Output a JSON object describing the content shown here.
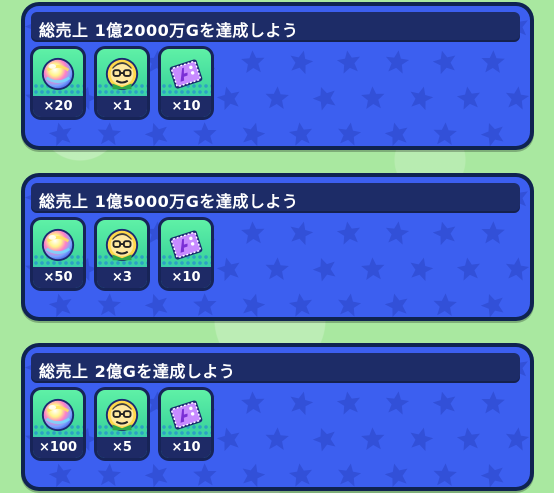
{
  "missions": [
    {
      "title": "総売上 1億2000万Gを達成しよう",
      "rewards": [
        {
          "icon": "rainbow-orb-icon",
          "count": "×20"
        },
        {
          "icon": "character-face-icon",
          "count": "×1"
        },
        {
          "icon": "purple-ticket-icon",
          "count": "×10"
        }
      ]
    },
    {
      "title": "総売上 1億5000万Gを達成しよう",
      "rewards": [
        {
          "icon": "rainbow-orb-icon",
          "count": "×50"
        },
        {
          "icon": "character-face-icon",
          "count": "×3"
        },
        {
          "icon": "purple-ticket-icon",
          "count": "×10"
        }
      ]
    },
    {
      "title": "総売上 2億Gを達成しよう",
      "rewards": [
        {
          "icon": "rainbow-orb-icon",
          "count": "×100"
        },
        {
          "icon": "character-face-icon",
          "count": "×5"
        },
        {
          "icon": "purple-ticket-icon",
          "count": "×10"
        }
      ]
    }
  ],
  "colors": {
    "background": "#a9e8a0",
    "card_border": "#0f2350",
    "card_fill": "#3c5ff0",
    "title_bar": "#1d2c67",
    "reward_top": "#5ff1a6"
  }
}
